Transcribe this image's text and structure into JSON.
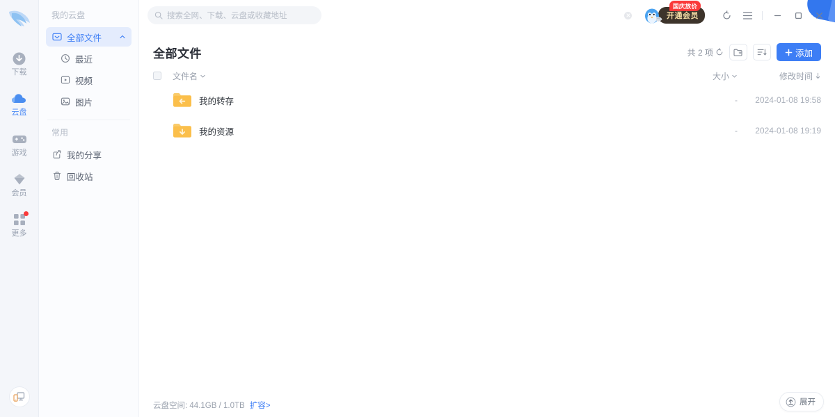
{
  "app": {
    "logo": "bird-logo"
  },
  "rail": {
    "items": [
      {
        "label": "下载",
        "icon": "download-circle-icon",
        "active": false,
        "badge": false
      },
      {
        "label": "云盘",
        "icon": "cloud-icon",
        "active": true,
        "badge": false
      },
      {
        "label": "游戏",
        "icon": "gamepad-icon",
        "active": false,
        "badge": false
      },
      {
        "label": "会员",
        "icon": "diamond-icon",
        "active": false,
        "badge": false
      },
      {
        "label": "更多",
        "icon": "grid-icon",
        "active": false,
        "badge": true
      }
    ],
    "bottom_button": "phone-transfer-icon"
  },
  "sidebar": {
    "section_title": "我的云盘",
    "items": [
      {
        "label": "全部文件",
        "icon": "folder-down-icon",
        "active": true,
        "sub": false,
        "chevron": "chevron-up"
      },
      {
        "label": "最近",
        "icon": "clock-icon",
        "active": false,
        "sub": true,
        "chevron": ""
      },
      {
        "label": "视频",
        "icon": "video-icon",
        "active": false,
        "sub": true,
        "chevron": ""
      },
      {
        "label": "图片",
        "icon": "image-icon",
        "active": false,
        "sub": true,
        "chevron": ""
      }
    ],
    "section_title2": "常用",
    "items2": [
      {
        "label": "我的分享",
        "icon": "share-icon",
        "active": false
      },
      {
        "label": "回收站",
        "icon": "trash-icon",
        "active": false
      }
    ]
  },
  "search": {
    "placeholder": "搜索全网、下载、云盘或收藏地址",
    "value": "",
    "icon": "search-icon"
  },
  "titlebar": {
    "tiny_close": "close-small-icon",
    "vip_tag": "国庆放价",
    "vip_button": "开通会员",
    "avatar": "penguin-avatar",
    "history_icon": "refresh-history-icon",
    "menu_icon": "hamburger-menu-icon",
    "minimize_icon": "minimize-icon",
    "maximize_icon": "maximize-icon",
    "close_icon": "close-icon"
  },
  "page": {
    "title": "全部文件",
    "count_text": "共 2 项",
    "refresh_icon": "refresh-icon",
    "new_folder_icon": "new-folder-icon",
    "sort_icon": "sort-list-icon",
    "add_button": "添加",
    "add_icon": "plus-icon"
  },
  "table": {
    "columns": {
      "name": "文件名",
      "size": "大小",
      "time": "修改时间"
    },
    "sort": {
      "name_chevron": "chevron-down",
      "size_chevron": "chevron-down",
      "time_arrow": "arrow-down"
    },
    "rows": [
      {
        "name": "我的转存",
        "size": "-",
        "time": "2024-01-08 19:58",
        "icon": "folder-left-arrow-icon"
      },
      {
        "name": "我的资源",
        "size": "-",
        "time": "2024-01-08 19:19",
        "icon": "folder-down-arrow-icon"
      }
    ]
  },
  "footer": {
    "storage_label": "云盘空间:",
    "storage_value": "44.1GB / 1.0TB",
    "storage_link": "扩容>",
    "expand_label": "展开",
    "expand_icon": "upload-icon"
  },
  "colors": {
    "accent": "#3d7ef5",
    "accent_soft": "#e4ecfd",
    "folder": "#f7c05a",
    "vip_dark": "#3d342b",
    "vip_gold": "#f6dfa8",
    "red": "#fa3a3a",
    "rail_bg": "#f4f6fa",
    "sidebar_bg": "#fbfcfe"
  }
}
